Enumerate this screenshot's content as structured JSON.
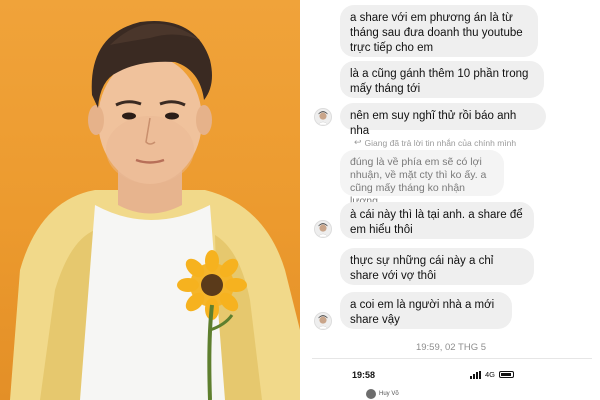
{
  "messages": [
    {
      "text": "a share với em phương án là từ tháng sau đưa doanh thu youtube trực tiếp cho em",
      "avatar": false
    },
    {
      "text": "là a cũng gánh thêm 10 phần trong mấy tháng tới",
      "avatar": false
    },
    {
      "text": "nên em suy nghĩ thử rồi báo anh nha",
      "avatar": true
    },
    {
      "text": "đúng là về phía em sẽ có lợi nhuận, về mặt cty thì ko ấy. a cũng mấy tháng ko nhận lương",
      "avatar": false,
      "faded": true
    },
    {
      "text": "à cái này thì là tại anh. a share để em hiểu thôi",
      "avatar": true
    },
    {
      "text": "thực sự những cái này a chỉ share với vợ thôi",
      "avatar": false
    },
    {
      "text": "a coi em là người nhà a mới share vậy",
      "avatar": true
    }
  ],
  "reply_note": "Giang đã trả lời tin nhắn của chính mình",
  "timestamp": "19:59, 02 THG 5",
  "status_bar": {
    "time": "19:58",
    "network": "4G"
  },
  "footer_name": "Huy Võ",
  "colors": {
    "bubble": "#efefef",
    "background_photo": "#ef9f33",
    "text": "#111111"
  }
}
